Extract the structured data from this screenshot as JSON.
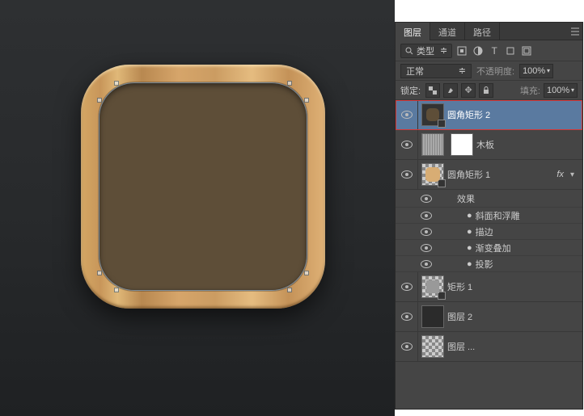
{
  "panel": {
    "tabs": [
      "图层",
      "通道",
      "路径"
    ],
    "active_tab": 0,
    "filter_label": "类型",
    "blend_mode": "正常",
    "opacity_label": "不透明度:",
    "opacity_value": "100%",
    "lock_label": "锁定:",
    "fill_label": "填充:",
    "fill_value": "100%",
    "fx_label": "fx",
    "effects_header": "效果",
    "effects": [
      "斜面和浮雕",
      "描边",
      "渐变叠加",
      "投影"
    ],
    "layers": [
      {
        "name": "圆角矩形 2",
        "selected": true
      },
      {
        "name": "木板"
      },
      {
        "name": "圆角矩形 1",
        "fx": true
      },
      {
        "name": "矩形 1"
      },
      {
        "name": "图层 2"
      },
      {
        "name": "图层 ..."
      }
    ]
  }
}
